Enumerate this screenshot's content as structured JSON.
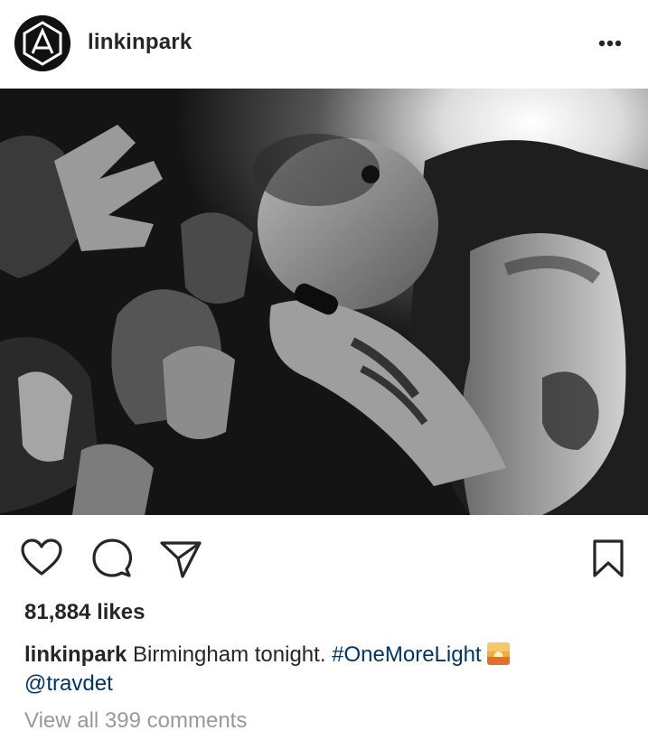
{
  "post": {
    "username": "linkinpark",
    "likes": "81,884 likes",
    "caption": {
      "username": "linkinpark",
      "text": "Birmingham tonight.",
      "hashtag": "#OneMoreLight",
      "emoji": "sunrise-emoji",
      "mention": "@travdet"
    },
    "view_comments": "View all 399 comments"
  },
  "icons": {
    "avatar": "linkin-park-logo-icon",
    "more": "more-options-icon",
    "like": "heart-icon",
    "comment": "comment-bubble-icon",
    "share": "paper-plane-icon",
    "save": "bookmark-icon"
  },
  "colors": {
    "text": "#262626",
    "link": "#003569",
    "muted": "#999999"
  }
}
